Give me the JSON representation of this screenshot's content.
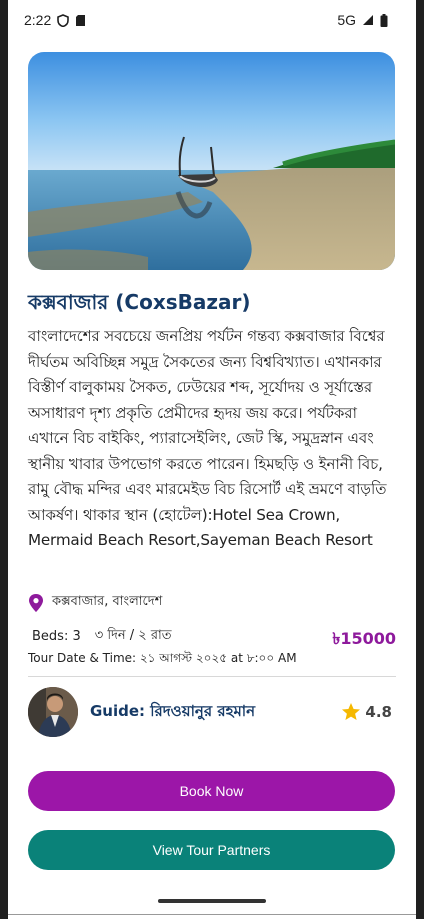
{
  "status_bar": {
    "time": "2:22",
    "network": "5G"
  },
  "tour": {
    "image_alt_icon": "beach-boat-photo",
    "title": "কক্সবাজার (CoxsBazar)",
    "description": "বাংলাদেশের সবচেয়ে জনপ্রিয় পর্যটন গন্তব্য কক্সবাজার বিশ্বের দীর্ঘতম অবিচ্ছিন্ন সমুদ্র সৈকতের জন্য বিশ্ববিখ্যাত। এখানকার বিস্তীর্ণ বালুকাময় সৈকত, ঢেউয়ের শব্দ, সূর্যোদয় ও সূর্যাস্তের অসাধারণ দৃশ্য প্রকৃতি প্রেমীদের হৃদয় জয় করে। পর্যটকরা এখানে বিচ বাইকিং, প্যারাসেইলিং, জেট স্কি, সমুদ্রস্নান এবং স্থানীয় খাবার উপভোগ করতে পারেন। হিমছড়ি ও ইনানী বিচ, রামু বৌদ্ধ মন্দির এবং মারমেইড বিচ রিসোর্ট এই ভ্রমণে বাড়তি আকর্ষণ। থাকার স্থান (হোটেল):Hotel Sea Crown, Mermaid Beach Resort,Sayeman Beach Resort",
    "location": "কক্সবাজার, বাংলাদেশ",
    "beds": "Beds: 3",
    "duration": "৩ দিন / ২ রাত",
    "price": "৳15000",
    "tour_date": "Tour Date & Time: ২১ আগস্ট ২০২৫ at ৮:০০ AM"
  },
  "guide": {
    "name": "Guide: রিদওয়ানুর রহমান",
    "rating": "4.8"
  },
  "buttons": {
    "book": "Book Now",
    "partners": "View Tour Partners"
  },
  "colors": {
    "title": "#163a66",
    "price": "#8e1a9c",
    "book_button": "#9c16a8",
    "partners_button": "#0a8279",
    "star": "#f5b800"
  }
}
